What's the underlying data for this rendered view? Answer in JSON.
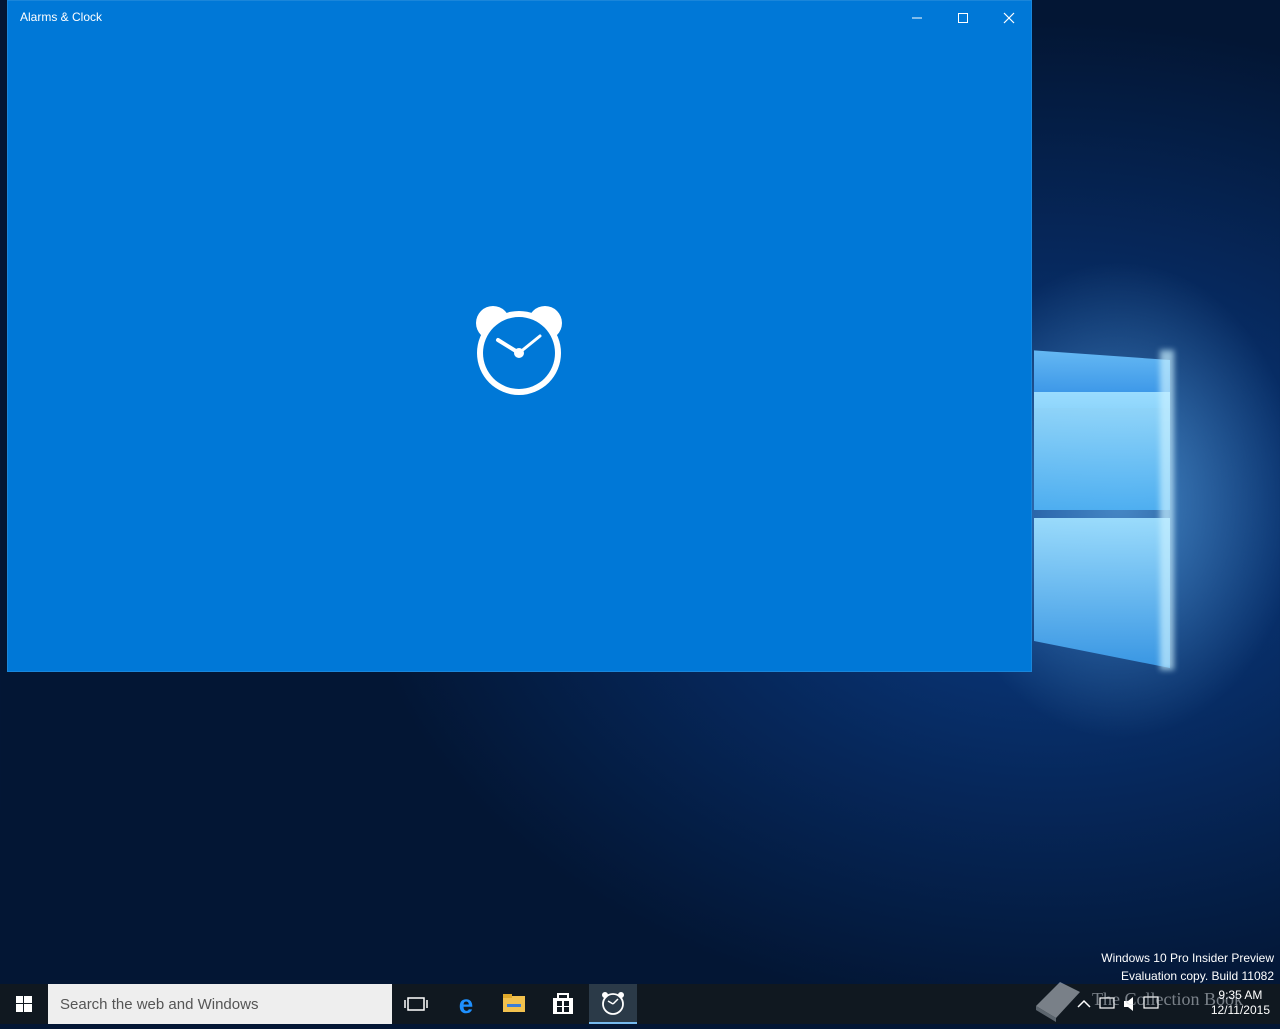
{
  "window": {
    "title": "Alarms & Clock",
    "controls": {
      "minimize": "minimize-icon",
      "maximize": "maximize-icon",
      "close": "close-icon"
    },
    "splash_icon": "alarm-clock-icon",
    "bg_color": "#0078d7"
  },
  "watermark": {
    "line1": "Windows 10 Pro Insider Preview",
    "line2": "Evaluation copy. Build 11082"
  },
  "taskbar": {
    "search_placeholder": "Search the web and Windows",
    "apps": [
      "task-view-icon",
      "edge-icon",
      "file-explorer-icon",
      "store-icon",
      "alarms-clock-icon"
    ],
    "clock_time": "9:35 AM",
    "clock_date": "12/11/2015"
  },
  "overlay": {
    "text": "The Collection Book"
  }
}
